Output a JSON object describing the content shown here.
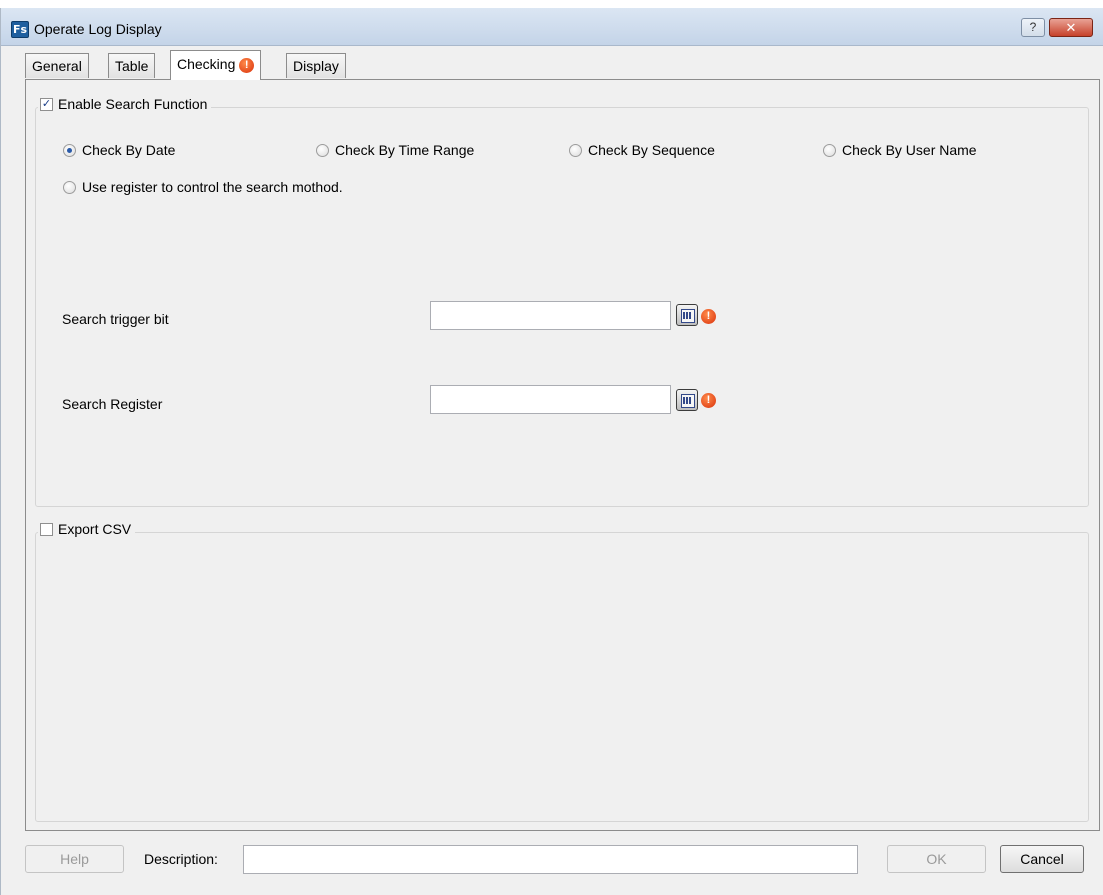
{
  "window": {
    "title": "Operate Log Display",
    "icon_text": "Fs",
    "help_label": "?",
    "close_label": "✕"
  },
  "tabs": [
    {
      "label": "General"
    },
    {
      "label": "Table"
    },
    {
      "label": "Checking",
      "warning": true,
      "active": true
    },
    {
      "label": "Display"
    }
  ],
  "search": {
    "enable_label": "Enable Search Function",
    "enabled": true,
    "options": [
      {
        "label": "Check By Date",
        "selected": true
      },
      {
        "label": "Check By Time Range",
        "selected": false
      },
      {
        "label": "Check By Sequence",
        "selected": false
      },
      {
        "label": "Check By User Name",
        "selected": false
      },
      {
        "label": "Use register to control the search mothod.",
        "selected": false
      }
    ],
    "trigger_bit_label": "Search trigger bit",
    "trigger_bit_value": "",
    "register_label": "Search Register",
    "register_value": ""
  },
  "export": {
    "label": "Export CSV",
    "checked": false
  },
  "footer": {
    "help_label": "Help",
    "description_label": "Description:",
    "description_value": "",
    "ok_label": "OK",
    "cancel_label": "Cancel"
  },
  "icons": {
    "warning_glyph": "!",
    "checkmark_glyph": "✓"
  },
  "colors": {
    "titlebar": "#c4d4e8",
    "close_button": "#c6412a",
    "warning": "#d9310b"
  }
}
